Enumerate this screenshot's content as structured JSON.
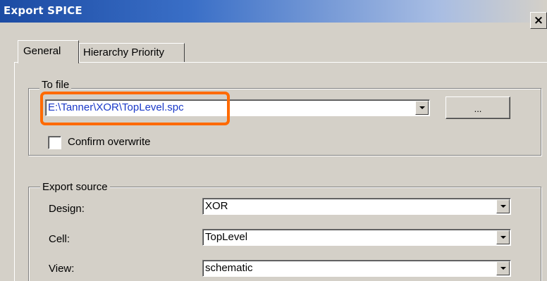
{
  "window": {
    "title": "Export SPICE",
    "close_glyph": "×"
  },
  "tabs": [
    {
      "label": "General",
      "active": true
    },
    {
      "label": "Hierarchy Priority",
      "active": false
    }
  ],
  "to_file": {
    "legend": "To file",
    "path": "E:\\Tanner\\XOR\\TopLevel.spc",
    "browse_label": "...",
    "confirm_overwrite_label": "Confirm overwrite",
    "confirm_overwrite_checked": false
  },
  "export_source": {
    "legend": "Export source",
    "design_label": "Design:",
    "design_value": "XOR",
    "cell_label": "Cell:",
    "cell_value": "TopLevel",
    "view_label": "View:",
    "view_value": "schematic"
  },
  "colors": {
    "highlight": "#ff6a00",
    "path_text": "#1a39c8",
    "title_bar": "#1c4ba3"
  }
}
